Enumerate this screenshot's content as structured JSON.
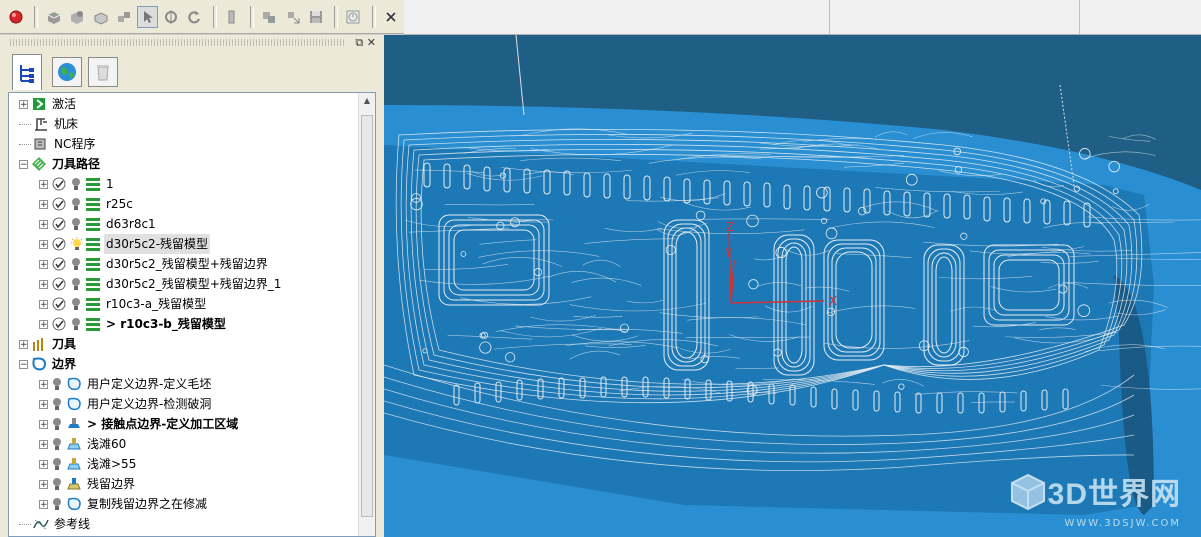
{
  "toolbar": {
    "icons": [
      "stop-icon",
      "solid-icon",
      "shaded-icon",
      "wireframe-icon",
      "blocks-icon",
      "select-icon",
      "rotate-icon",
      "refresh-icon",
      "toolbar-split-icon",
      "duplicate-icon",
      "move-icon",
      "save-icon",
      "timer-icon",
      "close-icon"
    ]
  },
  "panel": {
    "close_glyph": "✕",
    "float_glyph": "⧉",
    "tabs": [
      "explorer-tree-icon",
      "globe-icon",
      "recycle-bin-icon"
    ]
  },
  "tree": {
    "items": [
      {
        "label": "激活",
        "icon": "activate-icon"
      },
      {
        "label": "机床",
        "icon": "machine-icon"
      },
      {
        "label": "NC程序",
        "icon": "nc-program-icon"
      },
      {
        "label": "刀具路径",
        "icon": "toolpath-folder-icon"
      },
      {
        "label": "1",
        "icon": "toolpath-icon"
      },
      {
        "label": "r25c",
        "icon": "toolpath-icon"
      },
      {
        "label": "d63r8c1",
        "icon": "toolpath-icon"
      },
      {
        "label": "d30r5c2-残留模型",
        "icon": "toolpath-icon"
      },
      {
        "label": "d30r5c2_残留模型+残留边界",
        "icon": "toolpath-icon"
      },
      {
        "label": "d30r5c2_残留模型+残留边界_1",
        "icon": "toolpath-icon"
      },
      {
        "label": "r10c3-a_残留模型",
        "icon": "toolpath-icon"
      },
      {
        "label": "> r10c3-b_残留模型",
        "icon": "toolpath-icon"
      },
      {
        "label": "刀具",
        "icon": "tools-icon"
      },
      {
        "label": "边界",
        "icon": "boundary-folder-icon"
      },
      {
        "label": "用户定义边界-定义毛坯",
        "icon": "boundary-icon"
      },
      {
        "label": "用户定义边界-检测破洞",
        "icon": "boundary-icon"
      },
      {
        "label": "> 接触点边界-定义加工区域",
        "icon": "contact-boundary-icon"
      },
      {
        "label": "浅滩60",
        "icon": "shallow-boundary-icon"
      },
      {
        "label": "浅滩>55",
        "icon": "shallow-boundary-icon"
      },
      {
        "label": "残留边界",
        "icon": "stock-boundary-icon"
      },
      {
        "label": "复制残留边界之在修减",
        "icon": "boundary-icon"
      },
      {
        "label": "参考线",
        "icon": "pattern-icon"
      }
    ]
  },
  "viewport": {
    "axis_labels": [
      "Z",
      "Y",
      "X"
    ],
    "watermark_text": "3D世界网",
    "watermark_url": "WWW.3DSJW.COM",
    "colors": {
      "background": "#1f5f86",
      "part": "#2a8fd2",
      "wire": "#e8eef2"
    }
  }
}
